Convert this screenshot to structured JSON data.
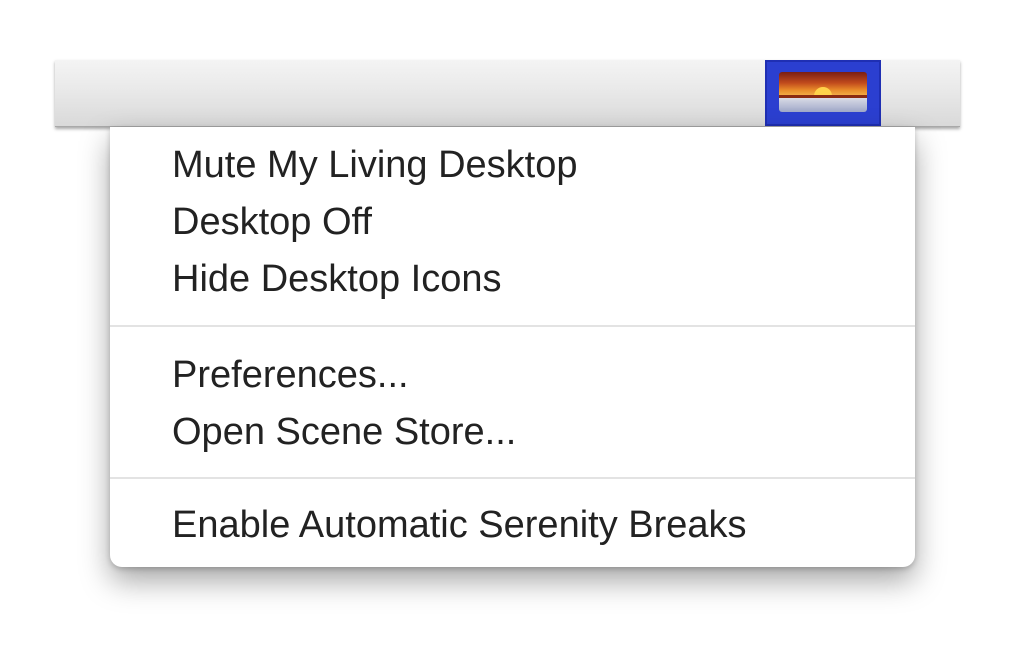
{
  "status_bar": {
    "icon": "sunset-landscape-icon",
    "highlight_color": "#2b3fd0"
  },
  "menu": {
    "groups": [
      {
        "items": [
          {
            "label": "Mute My Living Desktop"
          },
          {
            "label": "Desktop Off"
          },
          {
            "label": "Hide Desktop Icons"
          }
        ]
      },
      {
        "items": [
          {
            "label": "Preferences..."
          },
          {
            "label": "Open Scene Store..."
          }
        ]
      },
      {
        "items": [
          {
            "label": "Enable Automatic Serenity Breaks"
          }
        ]
      }
    ]
  }
}
